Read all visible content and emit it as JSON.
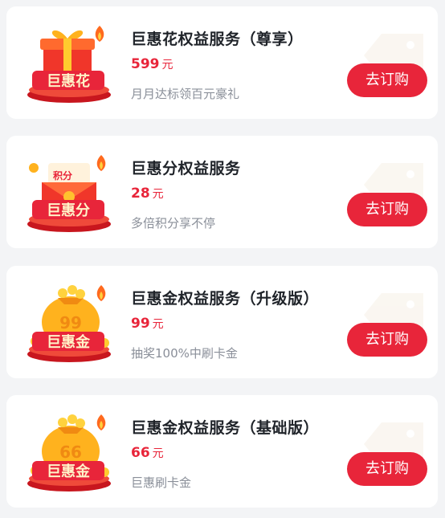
{
  "colors": {
    "accent": "#e8253a",
    "title": "#1f2329",
    "desc": "#8a8f99",
    "background": "#f3f4f6"
  },
  "items": [
    {
      "icon": "gift-box-icon",
      "badge": "巨惠花",
      "title": "巨惠花权益服务（尊享）",
      "price": "599",
      "unit": "元",
      "desc": "月月达标领百元豪礼",
      "button": "去订购"
    },
    {
      "icon": "points-envelope-icon",
      "badge": "巨惠分",
      "badge_top": "积分",
      "title": "巨惠分权益服务",
      "price": "28",
      "unit": "元",
      "desc": "多倍积分享不停",
      "button": "去订购"
    },
    {
      "icon": "money-bag-icon",
      "badge": "巨惠金",
      "badge_top": "99",
      "title": "巨惠金权益服务（升级版）",
      "price": "99",
      "unit": "元",
      "desc": "抽奖100%中刷卡金",
      "button": "去订购"
    },
    {
      "icon": "money-bag-icon",
      "badge": "巨惠金",
      "badge_top": "66",
      "title": "巨惠金权益服务（基础版）",
      "price": "66",
      "unit": "元",
      "desc": "巨惠刷卡金",
      "button": "去订购"
    }
  ]
}
